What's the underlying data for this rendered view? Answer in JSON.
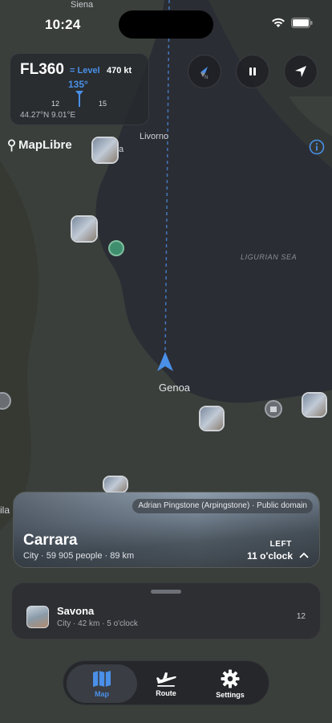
{
  "status": {
    "time": "10:24"
  },
  "map": {
    "top_city": "Siena",
    "livorno": "Livorno",
    "city_a": "a",
    "sea": "LIGURIAN SEA",
    "genoa": "Genoa",
    "ila": "ila",
    "brand": "MapLibre",
    "colors": {
      "sea": "#2b2d34",
      "land": "#3a3f3b",
      "route": "#4a90e8"
    }
  },
  "flight": {
    "altitude": "FL360",
    "vertical": "= Level",
    "speed": "470 kt",
    "heading": "135°",
    "tick_left": "12",
    "tick_right": "15",
    "coords": "44.27°N 9.01°E"
  },
  "controls": {
    "compass_icon": "compass-icon",
    "pause_icon": "pause-icon",
    "locate_icon": "location-arrow-icon",
    "info_icon": "info-icon"
  },
  "carrara": {
    "credit": "Adrian Pingstone (Arpingstone) · Public domain",
    "name": "Carrara",
    "subtitle": "City · 59 905 people · 89 km",
    "direction_label": "LEFT",
    "direction_value": "11 o'clock"
  },
  "list": {
    "items": [
      {
        "name": "Savona",
        "subtitle": "City · 42 km · 5 o'clock",
        "count": "12"
      }
    ]
  },
  "tabs": [
    {
      "label": "Map",
      "icon": "map-icon",
      "active": true
    },
    {
      "label": "Route",
      "icon": "plane-icon",
      "active": false
    },
    {
      "label": "Settings",
      "icon": "gear-icon",
      "active": false
    }
  ]
}
